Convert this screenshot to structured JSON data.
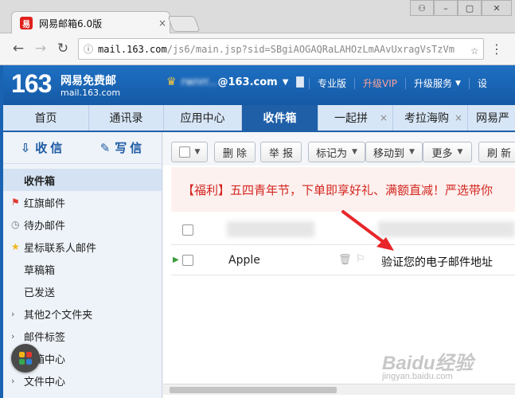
{
  "browser": {
    "tab_title": "网易邮箱6.0版",
    "tab_favicon_text": "易",
    "close_glyph": "×",
    "url_page_icon": "ⓘ",
    "url_domain": "mail.163.com",
    "url_path": "/js6/main.jsp?sid=SBgiAOGAQRaLAHOzLmAAvUxragVsTzVm",
    "star_glyph": "☆",
    "menu_glyph": "⋮",
    "back_glyph": "←",
    "forward_glyph": "→",
    "reload_glyph": "↻",
    "win_user_glyph": "⚇",
    "win_min_glyph": "–",
    "win_max_glyph": "▢",
    "win_close_glyph": "✕"
  },
  "header": {
    "logo": "163",
    "logo_title": "网易免费邮",
    "logo_domain": "mail.163.com",
    "account_name": "rwnrr...",
    "account_domain": "@163.com",
    "links": [
      "专业版",
      "升级VIP",
      "升级服务",
      "设"
    ],
    "vip_color": "#f8a39b"
  },
  "nav": {
    "tabs": [
      {
        "label": "首页",
        "active": false,
        "closable": false
      },
      {
        "label": "通讯录",
        "active": false,
        "closable": false
      },
      {
        "label": "应用中心",
        "active": false,
        "closable": false
      },
      {
        "label": "收件箱",
        "active": true,
        "closable": false
      },
      {
        "label": "一起拼",
        "active": false,
        "closable": true
      },
      {
        "label": "考拉海购",
        "active": false,
        "closable": true
      },
      {
        "label": "网易严",
        "active": false,
        "closable": false
      }
    ]
  },
  "sidebar": {
    "receive_label": "收信",
    "compose_label": "写信",
    "items": [
      {
        "label": "收件箱",
        "active": true
      },
      {
        "label": "红旗邮件"
      },
      {
        "label": "待办邮件"
      },
      {
        "label": "星标联系人邮件"
      },
      {
        "label": "草稿箱"
      },
      {
        "label": "已发送"
      },
      {
        "label": "其他2个文件夹"
      },
      {
        "label": "邮件标签"
      },
      {
        "label": "邮箱中心"
      },
      {
        "label": "文件中心"
      }
    ]
  },
  "toolbar": {
    "delete_label": "删 除",
    "report_label": "举 报",
    "mark_label": "标记为",
    "move_label": "移动到",
    "more_label": "更多",
    "refresh_label": "刷 新"
  },
  "promo": {
    "text": "【福利】五四青年节，下单即享好礼、满额直减！严选带你"
  },
  "mail_rows": [
    {
      "sender": "Apple",
      "subject": "验证您的电子邮件地址",
      "unread": true
    }
  ],
  "watermark": {
    "text": "Baidu经验",
    "sub": "jingyan.baidu.com"
  },
  "colors": {
    "brand_blue": "#1f5fa8",
    "promo_red": "#d3261f",
    "annotation_red": "#e8262a"
  }
}
